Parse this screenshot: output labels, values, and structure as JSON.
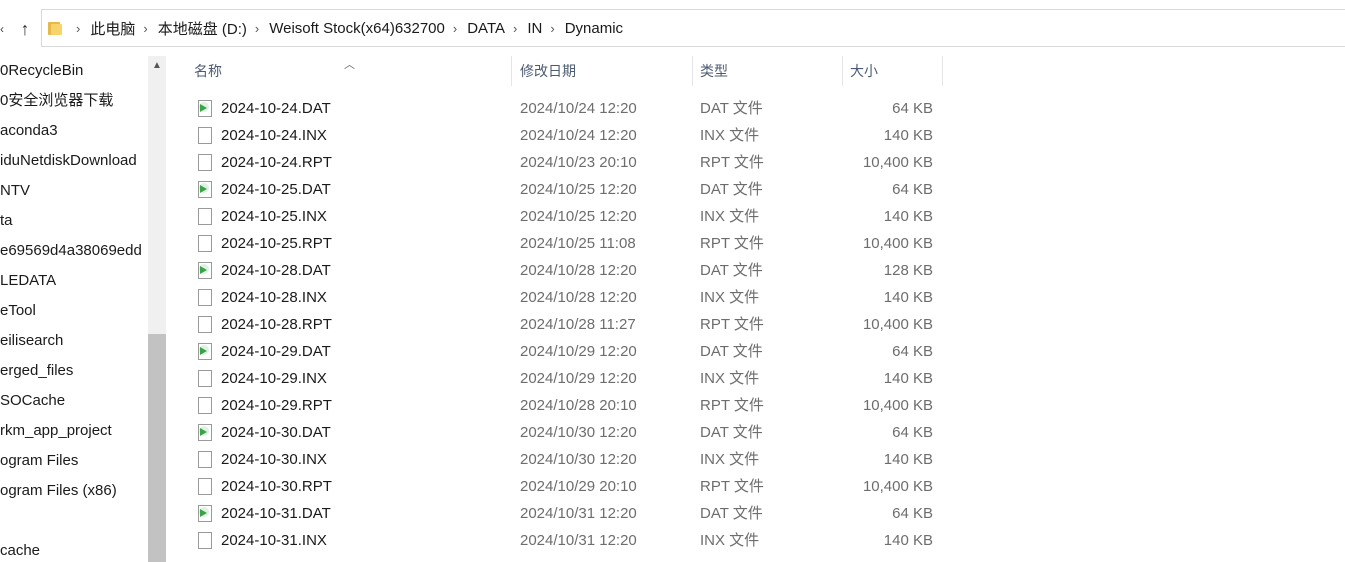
{
  "breadcrumb": [
    "此电脑",
    "本地磁盘 (D:)",
    "Weisoft Stock(x64)632700",
    "DATA",
    "IN",
    "Dynamic"
  ],
  "nav_items": [
    "0RecycleBin",
    "0安全浏览器下载",
    "aconda3",
    "iduNetdiskDownload",
    "NTV",
    "ta",
    "e69569d4a38069edd",
    "LEDATA",
    "eTool",
    "eilisearch",
    "erged_files",
    "SOCache",
    "rkm_app_project",
    "ogram Files",
    "ogram Files (x86)",
    "",
    "cache"
  ],
  "columns": {
    "name": "名称",
    "date": "修改日期",
    "type": "类型",
    "size": "大小"
  },
  "files": [
    {
      "name": "2024-10-24.DAT",
      "date": "2024/10/24 12:20",
      "type": "DAT 文件",
      "size": "64 KB",
      "icon": "dat-media-icon"
    },
    {
      "name": "2024-10-24.INX",
      "date": "2024/10/24 12:20",
      "type": "INX 文件",
      "size": "140 KB",
      "icon": "blank-file-icon"
    },
    {
      "name": "2024-10-24.RPT",
      "date": "2024/10/23 20:10",
      "type": "RPT 文件",
      "size": "10,400 KB",
      "icon": "blank-file-icon"
    },
    {
      "name": "2024-10-25.DAT",
      "date": "2024/10/25 12:20",
      "type": "DAT 文件",
      "size": "64 KB",
      "icon": "dat-media-icon"
    },
    {
      "name": "2024-10-25.INX",
      "date": "2024/10/25 12:20",
      "type": "INX 文件",
      "size": "140 KB",
      "icon": "blank-file-icon"
    },
    {
      "name": "2024-10-25.RPT",
      "date": "2024/10/25 11:08",
      "type": "RPT 文件",
      "size": "10,400 KB",
      "icon": "blank-file-icon"
    },
    {
      "name": "2024-10-28.DAT",
      "date": "2024/10/28 12:20",
      "type": "DAT 文件",
      "size": "128 KB",
      "icon": "dat-media-icon"
    },
    {
      "name": "2024-10-28.INX",
      "date": "2024/10/28 12:20",
      "type": "INX 文件",
      "size": "140 KB",
      "icon": "blank-file-icon"
    },
    {
      "name": "2024-10-28.RPT",
      "date": "2024/10/28 11:27",
      "type": "RPT 文件",
      "size": "10,400 KB",
      "icon": "blank-file-icon"
    },
    {
      "name": "2024-10-29.DAT",
      "date": "2024/10/29 12:20",
      "type": "DAT 文件",
      "size": "64 KB",
      "icon": "dat-media-icon"
    },
    {
      "name": "2024-10-29.INX",
      "date": "2024/10/29 12:20",
      "type": "INX 文件",
      "size": "140 KB",
      "icon": "blank-file-icon"
    },
    {
      "name": "2024-10-29.RPT",
      "date": "2024/10/28 20:10",
      "type": "RPT 文件",
      "size": "10,400 KB",
      "icon": "blank-file-icon"
    },
    {
      "name": "2024-10-30.DAT",
      "date": "2024/10/30 12:20",
      "type": "DAT 文件",
      "size": "64 KB",
      "icon": "dat-media-icon"
    },
    {
      "name": "2024-10-30.INX",
      "date": "2024/10/30 12:20",
      "type": "INX 文件",
      "size": "140 KB",
      "icon": "blank-file-icon"
    },
    {
      "name": "2024-10-30.RPT",
      "date": "2024/10/29 20:10",
      "type": "RPT 文件",
      "size": "10,400 KB",
      "icon": "blank-file-icon"
    },
    {
      "name": "2024-10-31.DAT",
      "date": "2024/10/31 12:20",
      "type": "DAT 文件",
      "size": "64 KB",
      "icon": "dat-media-icon"
    },
    {
      "name": "2024-10-31.INX",
      "date": "2024/10/31 12:20",
      "type": "INX 文件",
      "size": "140 KB",
      "icon": "blank-file-icon"
    }
  ],
  "colors": {
    "header_text": "#4c5b73",
    "secondary_text": "#6d6d6d",
    "folder": "#f6d36b"
  }
}
